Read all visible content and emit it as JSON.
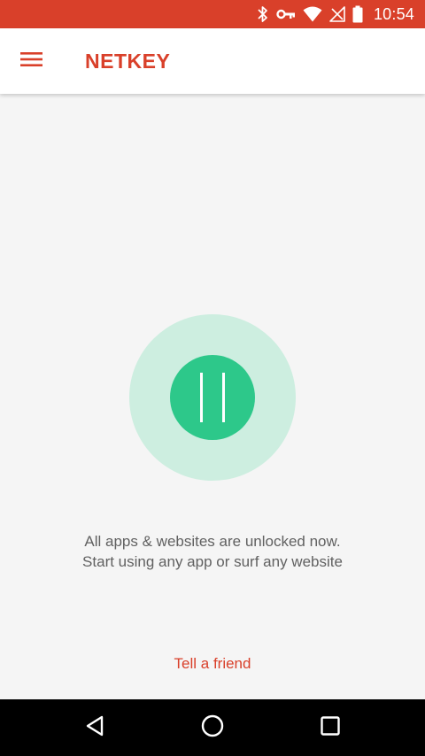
{
  "status_bar": {
    "time": "10:54",
    "icons": [
      "bluetooth-icon",
      "vpn-key-icon",
      "wifi-icon",
      "no-signal-icon",
      "battery-icon"
    ],
    "background_color": "#d9402a"
  },
  "app_bar": {
    "title": "NETKEY",
    "menu_icon": "hamburger-menu-icon",
    "title_color": "#d9402a"
  },
  "main": {
    "toggle": {
      "icon": "pause-icon",
      "state": "paused",
      "inner_color": "#2dc88a",
      "outer_color": "#cdeee0"
    },
    "message_line1": "All apps & websites are unlocked now.",
    "message_line2": "Start using any app or surf any website",
    "tell_friend_label": "Tell a friend"
  },
  "nav_bar": {
    "buttons": [
      "back-icon",
      "home-icon",
      "recents-icon"
    ]
  }
}
